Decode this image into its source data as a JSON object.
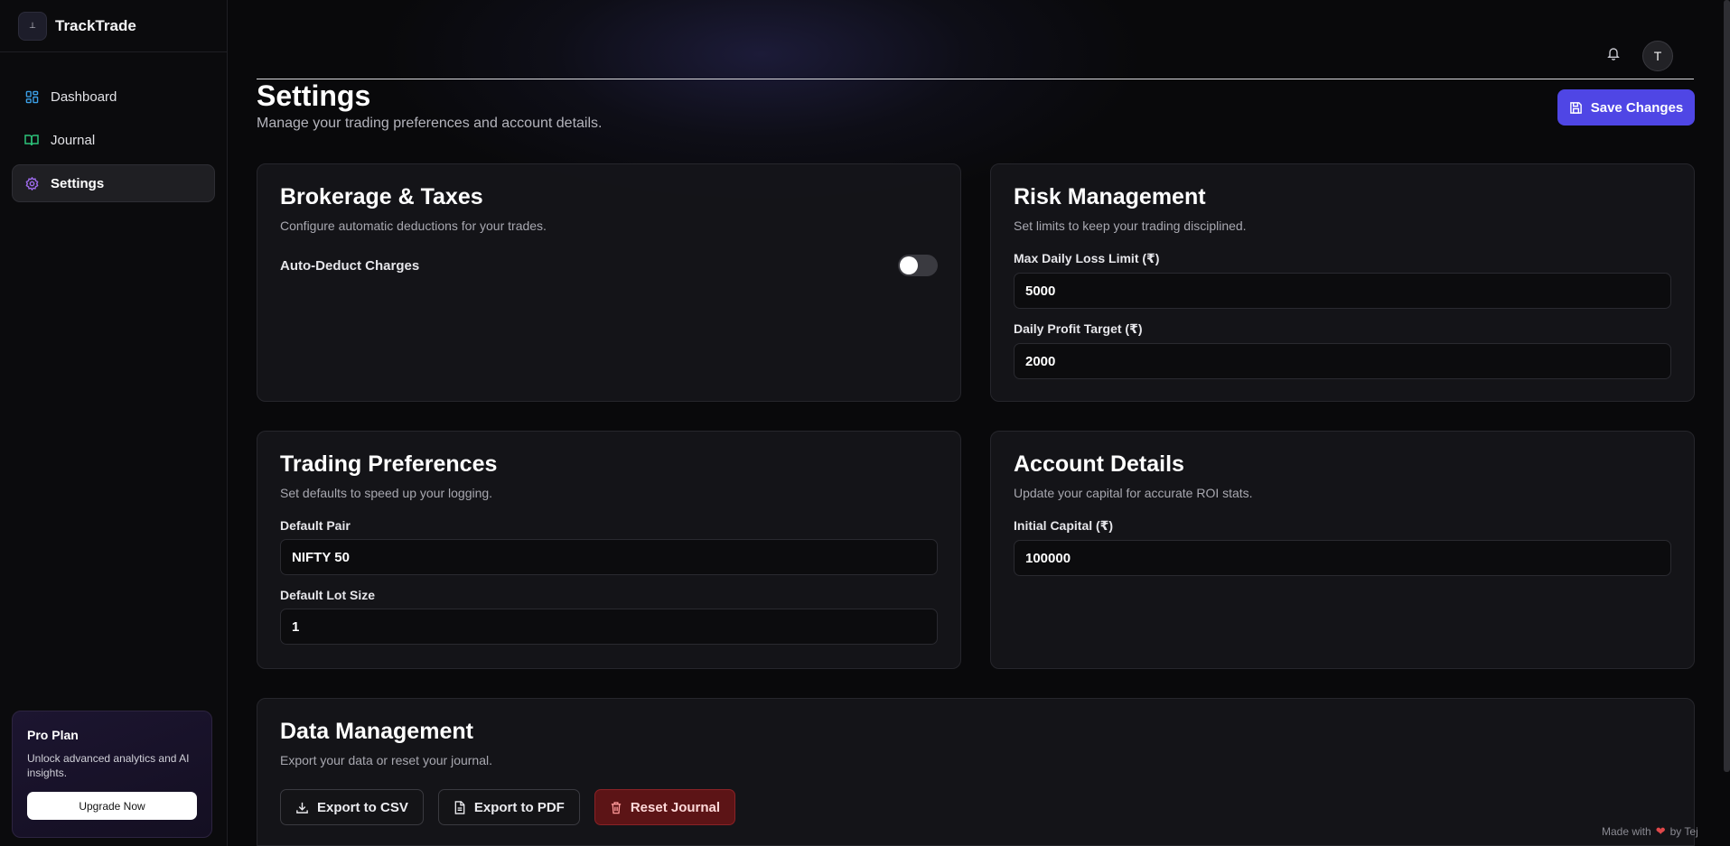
{
  "app": {
    "name": "TrackTrade",
    "logo_text": "⊥"
  },
  "sidebar": {
    "items": [
      {
        "label": "Dashboard",
        "icon": "layout-grid-icon",
        "color": "#3b9fe6"
      },
      {
        "label": "Journal",
        "icon": "book-open-icon",
        "color": "#2cc37a"
      },
      {
        "label": "Settings",
        "icon": "gear-icon",
        "color": "#a06cf0"
      }
    ],
    "pro": {
      "title": "Pro Plan",
      "desc": "Unlock advanced analytics and AI insights.",
      "button": "Upgrade Now"
    }
  },
  "header": {
    "avatar": "T"
  },
  "page": {
    "title": "Settings",
    "subtitle": "Manage your trading preferences and account details.",
    "save_label": "Save Changes",
    "accent": "#4f46e5"
  },
  "brokerage": {
    "title": "Brokerage & Taxes",
    "subtitle": "Configure automatic deductions for your trades.",
    "toggle_label": "Auto-Deduct Charges",
    "toggle_on": false
  },
  "risk": {
    "title": "Risk Management",
    "subtitle": "Set limits to keep your trading disciplined.",
    "loss_label": "Max Daily Loss Limit (₹)",
    "loss_value": "5000",
    "profit_label": "Daily Profit Target (₹)",
    "profit_value": "2000"
  },
  "trading": {
    "title": "Trading Preferences",
    "subtitle": "Set defaults to speed up your logging.",
    "pair_label": "Default Pair",
    "pair_value": "NIFTY 50",
    "lot_label": "Default Lot Size",
    "lot_value": "1"
  },
  "account": {
    "title": "Account Details",
    "subtitle": "Update your capital for accurate ROI stats.",
    "capital_label": "Initial Capital (₹)",
    "capital_value": "100000"
  },
  "data_mgmt": {
    "title": "Data Management",
    "subtitle": "Export your data or reset your journal.",
    "csv_label": "Export to CSV",
    "pdf_label": "Export to PDF",
    "reset_label": "Reset Journal",
    "danger_color": "#5c1416"
  },
  "footer": {
    "prefix": "Made with",
    "suffix": "by Tej"
  }
}
